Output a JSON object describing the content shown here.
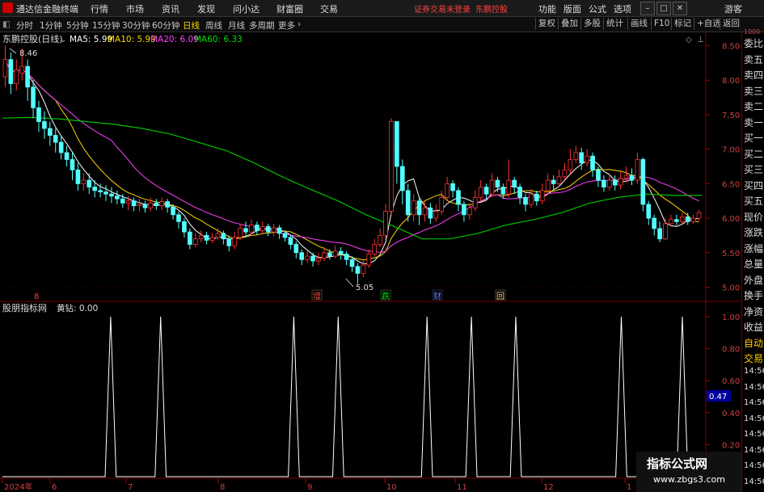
{
  "app": {
    "title": "通达信金融终端"
  },
  "menu": [
    "行情",
    "市场",
    "资讯",
    "发现",
    "问小达",
    "财富圈",
    "交易"
  ],
  "status": {
    "trade_login": "证券交易未登录",
    "stock_link": "东鹏控股"
  },
  "top_right": [
    "功能",
    "版面",
    "公式",
    "选项"
  ],
  "guest": "游客",
  "periods": [
    "分时",
    "1分钟",
    "5分钟",
    "15分钟",
    "30分钟",
    "60分钟",
    "日线",
    "周线",
    "月线",
    "多周期",
    "更多"
  ],
  "active_period": "日线",
  "tools": [
    "复权",
    "叠加",
    "多股",
    "统计",
    "画线",
    "F10",
    "标记",
    "+自选",
    "返回"
  ],
  "main_chart": {
    "stock_label": "东鹏控股(日线)",
    "ma": [
      {
        "label": "MA5: 5.99",
        "color": "#ffffff"
      },
      {
        "label": "MA10: 5.99",
        "color": "#ffd700"
      },
      {
        "label": "MA20: 6.09",
        "color": "#ff40ff"
      },
      {
        "label": "MA60: 6.33",
        "color": "#00e000"
      }
    ],
    "high_marker": "8.46",
    "low_marker": "5.05",
    "price_axis": [
      "8.50",
      "8.00",
      "7.50",
      "7.00",
      "6.50",
      "6.00",
      "5.50",
      "5.00"
    ],
    "events": [
      {
        "label": "8",
        "color": "#ff4040"
      },
      {
        "label": "增",
        "color": "#ff4040"
      },
      {
        "label": "跌",
        "color": "#00e000"
      },
      {
        "label": "财",
        "color": "#6080ff"
      },
      {
        "label": "回",
        "color": "#ffd080"
      }
    ]
  },
  "indicator_chart": {
    "name": "股朋指标网",
    "value_label": "黄钻: 0.00",
    "axis": [
      "1.00",
      "0.80",
      "0.60",
      "0.40",
      "0.20"
    ],
    "current_badge": "0.47"
  },
  "date_axis": [
    "2024年",
    "6",
    "7",
    "8",
    "9",
    "10",
    "11",
    "12",
    "1"
  ],
  "side_panel": {
    "top_label": "1000",
    "rows": [
      "委比",
      "卖五",
      "卖四",
      "卖三",
      "卖二",
      "卖一",
      "买一",
      "买二",
      "买三",
      "买四",
      "买五",
      "现价",
      "涨跌",
      "涨幅",
      "总量",
      "外盘",
      "换手",
      "净资",
      "收益",
      "自动",
      "交易"
    ],
    "times": [
      "14:56",
      "14:56",
      "14:56",
      "14:56",
      "14:56",
      "14:56",
      "14:56",
      "14:56"
    ]
  },
  "watermark": {
    "line1": "指标公式网",
    "line2": "www.zbgs3.com"
  },
  "chart_data": {
    "type": "candlestick",
    "ylim": [
      4.9,
      8.6
    ],
    "candles": [
      [
        8.05,
        8.3,
        8.5,
        7.9
      ],
      [
        8.3,
        7.95,
        8.4,
        7.8
      ],
      [
        7.95,
        8.15,
        8.3,
        7.85
      ],
      [
        8.1,
        8.2,
        8.46,
        8.0
      ],
      [
        8.2,
        7.9,
        8.3,
        7.7
      ],
      [
        7.9,
        7.6,
        8.0,
        7.45
      ],
      [
        7.6,
        7.4,
        7.7,
        7.25
      ],
      [
        7.4,
        7.3,
        7.55,
        7.15
      ],
      [
        7.3,
        7.2,
        7.4,
        7.05
      ],
      [
        7.2,
        7.1,
        7.3,
        6.95
      ],
      [
        7.1,
        6.95,
        7.2,
        6.85
      ],
      [
        6.95,
        6.85,
        7.05,
        6.75
      ],
      [
        6.85,
        6.7,
        6.95,
        6.55
      ],
      [
        6.7,
        6.5,
        6.8,
        6.4
      ],
      [
        6.5,
        6.55,
        6.65,
        6.4
      ],
      [
        6.55,
        6.45,
        6.65,
        6.35
      ],
      [
        6.45,
        6.4,
        6.55,
        6.3
      ],
      [
        6.4,
        6.38,
        6.5,
        6.3
      ],
      [
        6.38,
        6.35,
        6.48,
        6.25
      ],
      [
        6.35,
        6.32,
        6.45,
        6.22
      ],
      [
        6.32,
        6.28,
        6.4,
        6.2
      ],
      [
        6.28,
        6.22,
        6.35,
        6.15
      ],
      [
        6.22,
        6.25,
        6.32,
        6.12
      ],
      [
        6.25,
        6.18,
        6.3,
        6.1
      ],
      [
        6.18,
        6.2,
        6.28,
        6.1
      ],
      [
        6.2,
        6.15,
        6.25,
        6.08
      ],
      [
        6.15,
        6.22,
        6.3,
        6.1
      ],
      [
        6.22,
        6.18,
        6.28,
        6.12
      ],
      [
        6.18,
        6.24,
        6.3,
        6.12
      ],
      [
        6.24,
        6.16,
        6.28,
        6.08
      ],
      [
        6.16,
        6.05,
        6.2,
        5.98
      ],
      [
        6.05,
        5.95,
        6.1,
        5.85
      ],
      [
        5.95,
        5.8,
        6.0,
        5.72
      ],
      [
        5.8,
        5.62,
        5.85,
        5.55
      ],
      [
        5.62,
        5.7,
        5.78,
        5.58
      ],
      [
        5.7,
        5.75,
        5.82,
        5.65
      ],
      [
        5.75,
        5.68,
        5.8,
        5.62
      ],
      [
        5.68,
        5.72,
        5.78,
        5.64
      ],
      [
        5.72,
        5.78,
        5.85,
        5.68
      ],
      [
        5.78,
        5.7,
        5.82,
        5.62
      ],
      [
        5.7,
        5.6,
        5.75,
        5.52
      ],
      [
        5.6,
        5.72,
        5.8,
        5.55
      ],
      [
        5.72,
        5.85,
        5.92,
        5.68
      ],
      [
        5.85,
        5.8,
        5.95,
        5.72
      ],
      [
        5.8,
        5.9,
        5.98,
        5.75
      ],
      [
        5.9,
        5.82,
        5.95,
        5.76
      ],
      [
        5.82,
        5.88,
        5.95,
        5.78
      ],
      [
        5.88,
        5.8,
        5.92,
        5.74
      ],
      [
        5.8,
        5.86,
        5.92,
        5.74
      ],
      [
        5.86,
        5.78,
        5.9,
        5.7
      ],
      [
        5.78,
        5.72,
        5.82,
        5.66
      ],
      [
        5.72,
        5.62,
        5.76,
        5.55
      ],
      [
        5.62,
        5.5,
        5.66,
        5.42
      ],
      [
        5.5,
        5.4,
        5.55,
        5.32
      ],
      [
        5.4,
        5.45,
        5.52,
        5.35
      ],
      [
        5.45,
        5.38,
        5.5,
        5.3
      ],
      [
        5.38,
        5.42,
        5.5,
        5.32
      ],
      [
        5.42,
        5.5,
        5.58,
        5.38
      ],
      [
        5.5,
        5.45,
        5.55,
        5.4
      ],
      [
        5.45,
        5.52,
        5.6,
        5.42
      ],
      [
        5.52,
        5.48,
        5.58,
        5.4
      ],
      [
        5.48,
        5.4,
        5.52,
        5.32
      ],
      [
        5.4,
        5.3,
        5.45,
        5.22
      ],
      [
        5.3,
        5.2,
        5.35,
        5.05
      ],
      [
        5.2,
        5.32,
        5.4,
        5.15
      ],
      [
        5.32,
        5.48,
        5.55,
        5.28
      ],
      [
        5.48,
        5.62,
        5.7,
        5.45
      ],
      [
        5.62,
        5.75,
        5.85,
        5.58
      ],
      [
        5.75,
        6.1,
        6.2,
        5.7
      ],
      [
        6.1,
        7.4,
        7.45,
        6.05
      ],
      [
        7.4,
        6.75,
        7.1,
        6.5
      ],
      [
        6.75,
        6.4,
        6.85,
        6.2
      ],
      [
        6.4,
        6.05,
        6.5,
        5.95
      ],
      [
        6.05,
        6.25,
        6.35,
        5.95
      ],
      [
        6.25,
        6.05,
        6.3,
        5.9
      ],
      [
        6.05,
        6.15,
        6.25,
        5.95
      ],
      [
        6.15,
        6.0,
        6.22,
        5.92
      ],
      [
        6.0,
        6.1,
        6.2,
        5.95
      ],
      [
        6.1,
        6.3,
        6.4,
        6.05
      ],
      [
        6.3,
        6.5,
        6.6,
        6.25
      ],
      [
        6.5,
        6.4,
        6.55,
        6.3
      ],
      [
        6.4,
        6.2,
        6.45,
        6.1
      ],
      [
        6.2,
        6.05,
        6.25,
        5.95
      ],
      [
        6.05,
        6.15,
        6.22,
        5.98
      ],
      [
        6.15,
        6.3,
        6.4,
        6.1
      ],
      [
        6.3,
        6.45,
        6.55,
        6.25
      ],
      [
        6.45,
        6.35,
        6.5,
        6.28
      ],
      [
        6.35,
        6.55,
        6.65,
        6.3
      ],
      [
        6.55,
        6.45,
        6.6,
        6.38
      ],
      [
        6.45,
        6.35,
        6.5,
        6.28
      ],
      [
        6.35,
        6.55,
        6.85,
        6.3
      ],
      [
        6.55,
        6.45,
        6.6,
        6.35
      ],
      [
        6.45,
        6.3,
        6.5,
        6.2
      ],
      [
        6.3,
        6.2,
        6.35,
        6.1
      ],
      [
        6.2,
        6.35,
        6.42,
        6.15
      ],
      [
        6.35,
        6.25,
        6.4,
        6.18
      ],
      [
        6.25,
        6.4,
        6.5,
        6.2
      ],
      [
        6.4,
        6.55,
        6.65,
        6.35
      ],
      [
        6.55,
        6.5,
        6.62,
        6.42
      ],
      [
        6.5,
        6.6,
        6.7,
        6.45
      ],
      [
        6.6,
        6.7,
        6.8,
        6.55
      ],
      [
        6.7,
        6.85,
        7.0,
        6.65
      ],
      [
        6.85,
        6.95,
        7.05,
        6.8
      ],
      [
        6.95,
        6.8,
        7.02,
        6.7
      ],
      [
        6.8,
        6.9,
        7.0,
        6.75
      ],
      [
        6.9,
        6.7,
        6.95,
        6.6
      ],
      [
        6.7,
        6.55,
        6.75,
        6.45
      ],
      [
        6.55,
        6.45,
        6.62,
        6.38
      ],
      [
        6.45,
        6.55,
        6.65,
        6.4
      ],
      [
        6.55,
        6.48,
        6.62,
        6.4
      ],
      [
        6.48,
        6.58,
        6.68,
        6.42
      ],
      [
        6.58,
        6.62,
        6.75,
        6.52
      ],
      [
        6.62,
        6.55,
        6.72,
        6.48
      ],
      [
        6.55,
        6.85,
        6.95,
        6.5
      ],
      [
        6.85,
        6.2,
        6.88,
        6.1
      ],
      [
        6.2,
        6.0,
        6.25,
        5.9
      ],
      [
        6.0,
        5.85,
        6.05,
        5.75
      ],
      [
        5.85,
        5.7,
        5.95,
        5.65
      ],
      [
        5.7,
        5.92,
        6.0,
        5.68
      ],
      [
        5.92,
        5.98,
        6.05,
        5.88
      ],
      [
        5.98,
        5.95,
        6.05,
        5.9
      ],
      [
        5.95,
        6.02,
        6.08,
        5.92
      ],
      [
        6.02,
        5.95,
        6.08,
        5.9
      ],
      [
        5.95,
        6.0,
        6.05,
        5.92
      ],
      [
        6.0,
        6.08,
        6.12,
        5.96
      ]
    ],
    "ma60": [
      7.45,
      7.46,
      7.44,
      7.4,
      7.36,
      7.3,
      7.22,
      7.1,
      6.98,
      6.8,
      6.6,
      6.42,
      6.25,
      6.05,
      5.88,
      5.7,
      5.7,
      5.78,
      5.9,
      5.98,
      6.08,
      6.22,
      6.3,
      6.35,
      6.33,
      6.33
    ],
    "indicator_values": [
      0,
      0,
      0,
      0,
      0,
      0,
      0,
      0,
      0,
      0,
      0,
      0,
      0,
      0,
      0,
      0,
      0,
      0,
      0,
      1,
      0,
      0,
      0,
      0,
      0,
      0,
      0,
      0,
      1,
      0,
      0,
      0,
      0,
      0,
      0,
      0,
      0,
      0,
      0,
      0,
      0,
      0,
      0,
      0,
      0,
      0,
      0,
      0,
      0,
      0,
      0,
      0,
      1,
      0,
      0,
      0,
      0,
      0,
      0,
      0,
      1,
      0,
      0,
      0,
      0,
      0,
      0,
      0,
      0,
      0,
      0,
      0,
      0,
      0,
      0,
      0,
      1,
      0,
      0,
      0,
      0,
      0,
      0,
      0,
      1,
      0,
      0,
      0,
      0,
      0,
      0,
      0,
      1,
      0,
      0,
      0,
      0,
      0,
      0,
      0,
      0,
      0,
      0,
      0,
      0,
      0,
      0,
      0,
      0,
      0,
      0,
      1,
      0,
      0,
      0,
      0,
      0,
      0,
      0,
      0,
      0,
      0,
      1,
      0,
      0,
      0
    ]
  }
}
